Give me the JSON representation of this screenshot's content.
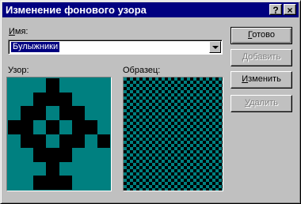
{
  "window": {
    "title": "Изменение фонового узора",
    "help_button": "?",
    "close_button": "×"
  },
  "name_field": {
    "label_key": "И",
    "label_rest": "мя:",
    "value": "Булыжники"
  },
  "pattern_label": "Узор:",
  "sample_label": "Образец:",
  "buttons": {
    "ok": {
      "key": "Г",
      "rest": "отово"
    },
    "add": {
      "key": "Д",
      "rest": "обавить"
    },
    "change": {
      "key": "И",
      "rest": "зменить"
    },
    "delete": {
      "key": "У",
      "rest": "далить"
    }
  },
  "pattern_bits": [
    [
      0,
      0,
      0,
      1,
      0,
      0,
      0,
      0
    ],
    [
      0,
      0,
      1,
      1,
      1,
      0,
      0,
      0
    ],
    [
      0,
      1,
      1,
      0,
      1,
      1,
      0,
      0
    ],
    [
      1,
      1,
      0,
      1,
      0,
      1,
      1,
      0
    ],
    [
      0,
      1,
      1,
      0,
      1,
      1,
      0,
      1
    ],
    [
      0,
      0,
      1,
      1,
      1,
      0,
      0,
      0
    ],
    [
      0,
      0,
      0,
      1,
      0,
      0,
      0,
      0
    ],
    [
      0,
      0,
      1,
      1,
      1,
      0,
      0,
      0
    ]
  ],
  "colors": {
    "title_bar": "#000080",
    "face": "#c0c0c0",
    "pattern_fg": "#000000",
    "pattern_bg": "#008080",
    "selection": "#000080"
  }
}
